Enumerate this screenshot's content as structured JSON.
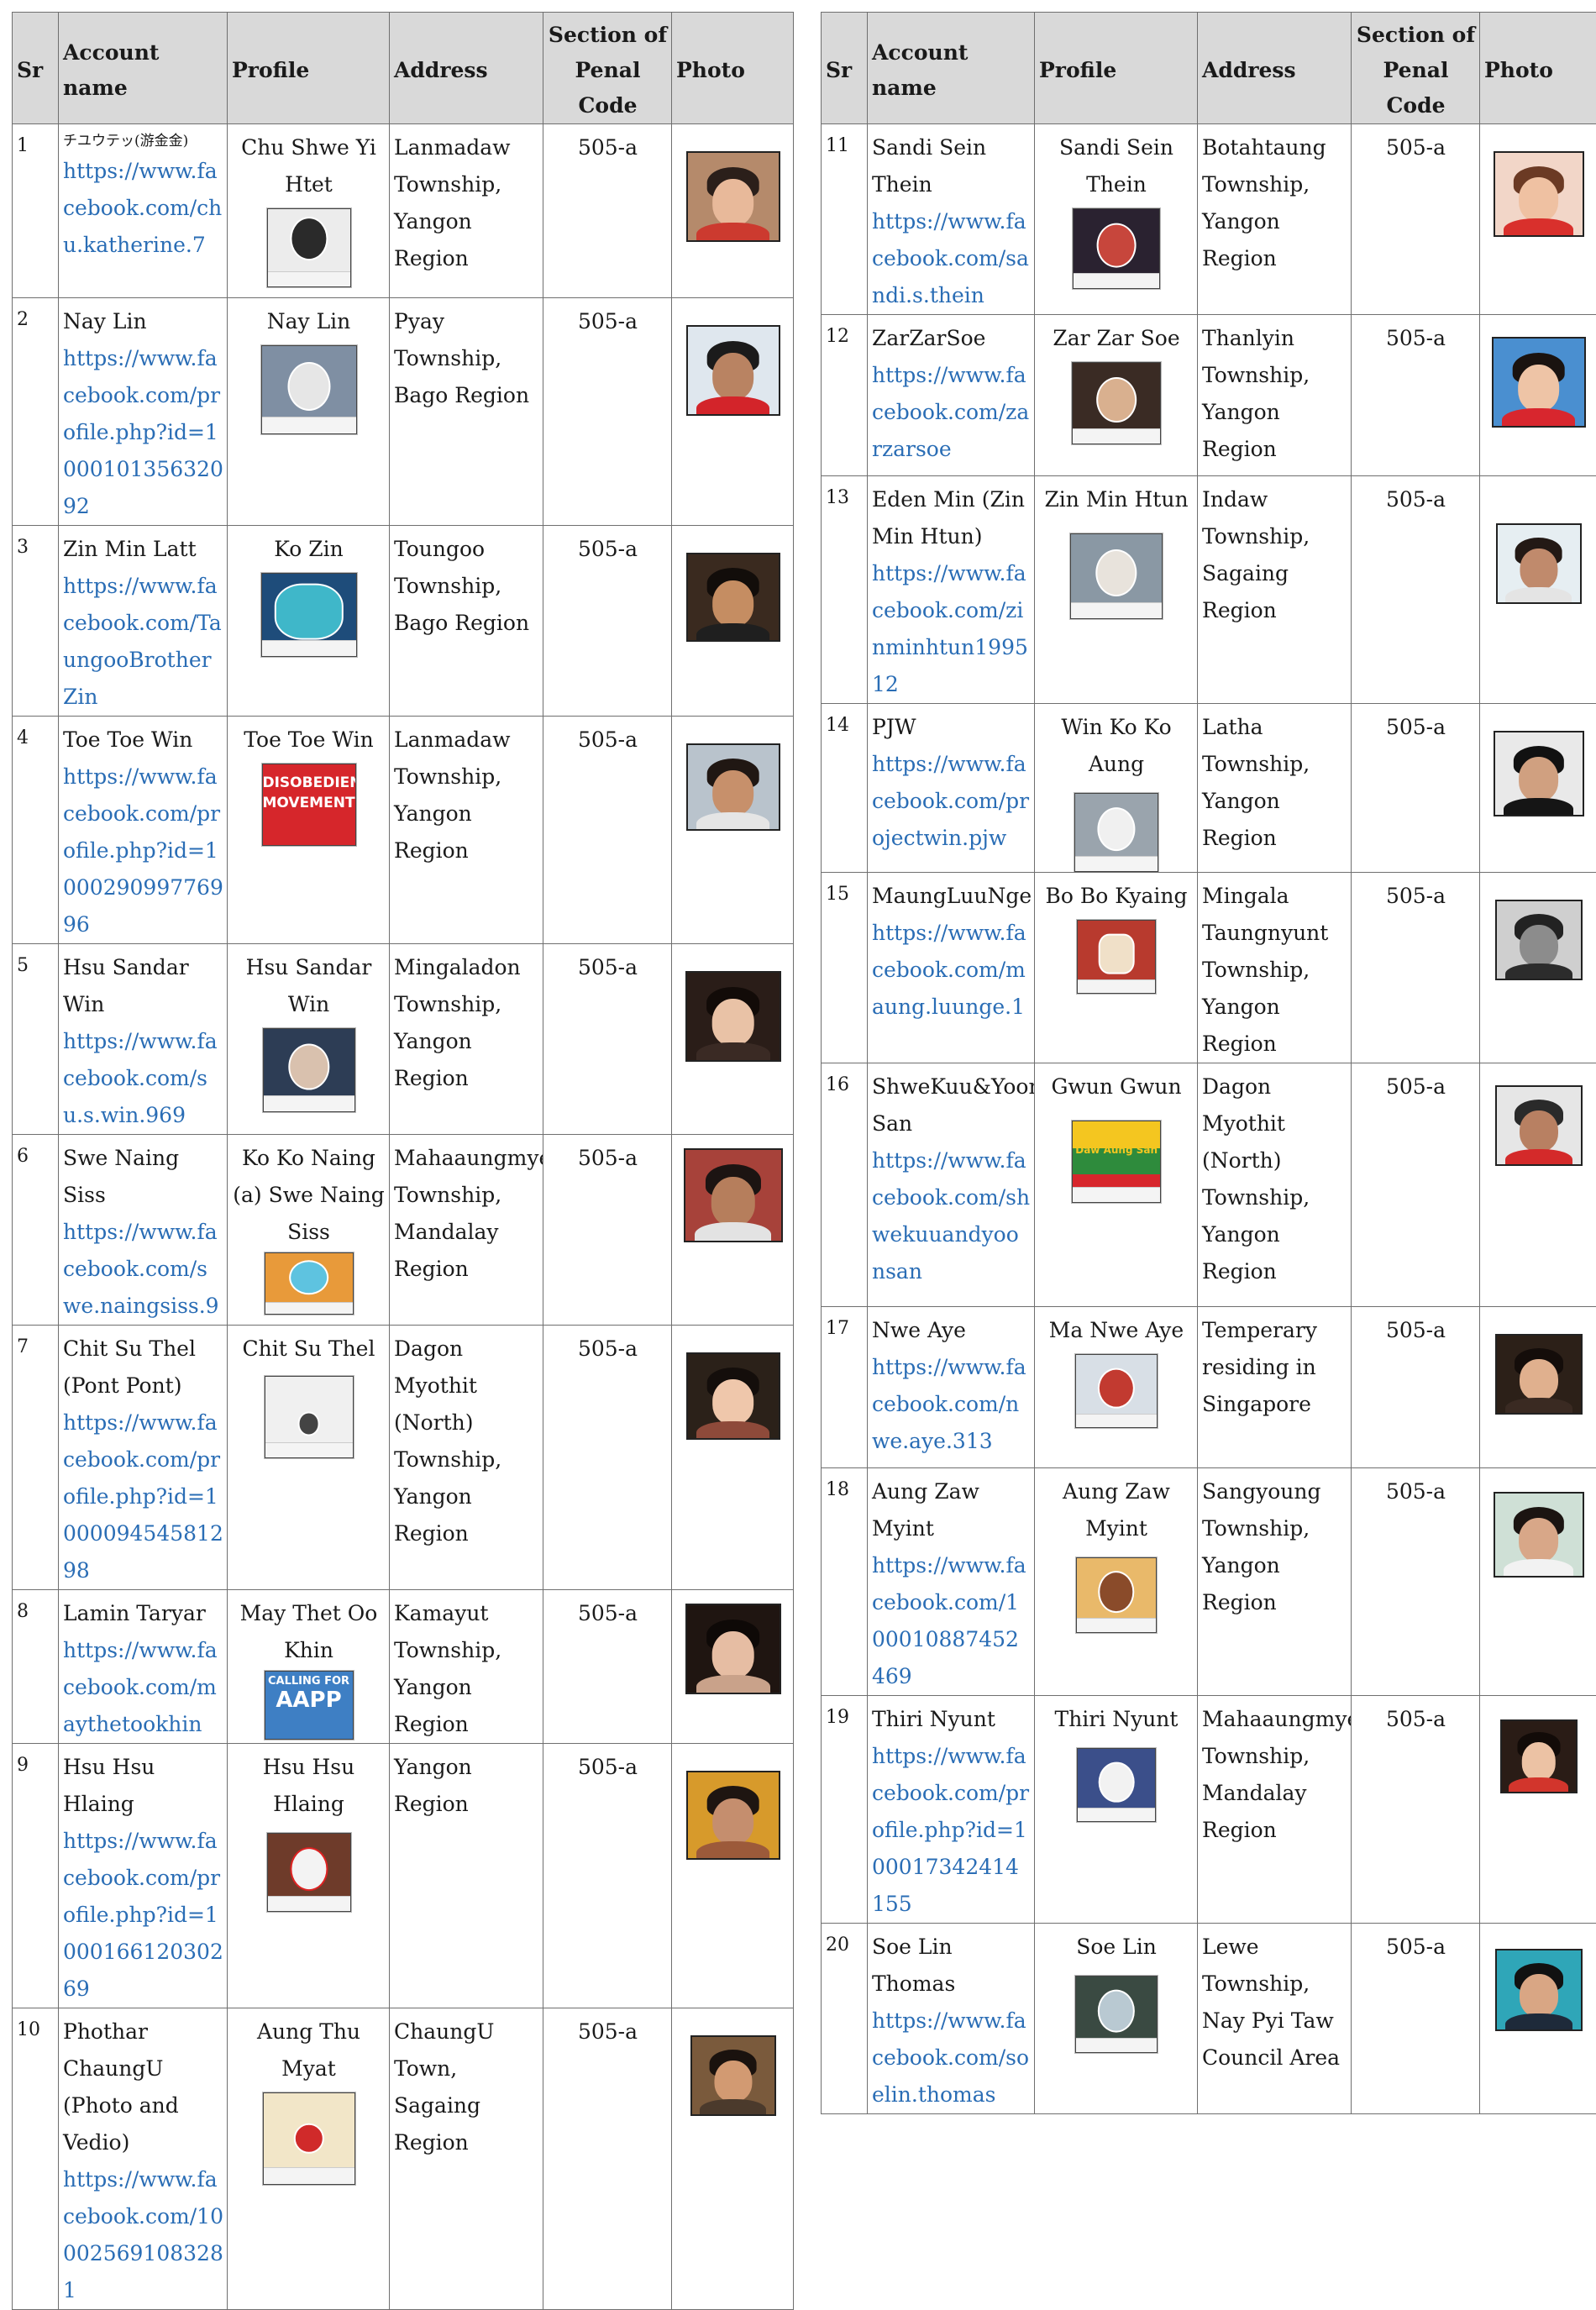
{
  "headers": {
    "sr": "Sr",
    "account_name": "Account name",
    "profile": "Profile",
    "address": "Address",
    "section_line1": "Section of",
    "section_line2": "Penal Code",
    "photo": "Photo"
  },
  "rows": [
    {
      "sr": "1",
      "account_name": "チユウテッ(游金金)",
      "url": "https://www.facebook.com/chu.katherine.7",
      "profile": "Chu Shwe Yi Htet",
      "address": "Lanmadaw Township, Yangon Region",
      "section": "505-a"
    },
    {
      "sr": "2",
      "account_name": "Nay Lin",
      "url": "https://www.facebook.com/profile.php?id=100010135632092",
      "profile": "Nay Lin",
      "address": "Pyay Township, Bago Region",
      "section": "505-a"
    },
    {
      "sr": "3",
      "account_name": "Zin Min Latt",
      "url": "https://www.facebook.com/TaungooBrotherZin",
      "profile": "Ko Zin",
      "address": "Toungoo Township, Bago Region",
      "section": "505-a"
    },
    {
      "sr": "4",
      "account_name": "Toe Toe Win",
      "url": "https://www.facebook.com/profile.php?id=100029099776996",
      "profile": "Toe Toe Win",
      "address": "Lanmadaw Township, Yangon Region",
      "section": "505-a",
      "banner": "DISOBEDIENCE MOVEMENT"
    },
    {
      "sr": "5",
      "account_name": "Hsu Sandar Win",
      "url": "https://www.facebook.com/su.s.win.969",
      "profile": "Hsu Sandar Win",
      "address": "Mingaladon Township, Yangon Region",
      "section": "505-a"
    },
    {
      "sr": "6",
      "account_name": "Swe Naing Siss",
      "url": "https://www.facebook.com/swe.naingsiss.9",
      "profile": "Ko Ko Naing (a) Swe Naing Siss",
      "address": "Mahaaungmye Township, Mandalay Region",
      "section": "505-a"
    },
    {
      "sr": "7",
      "account_name": "Chit Su Thel (Pont Pont)",
      "url": "https://www.facebook.com/profile.php?id=100009454581298",
      "profile": "Chit Su Thel",
      "address": "Dagon Myothit (North) Township, Yangon Region",
      "section": "505-a"
    },
    {
      "sr": "8",
      "account_name": "Lamin Taryar",
      "url": "https://www.facebook.com/maythetookhin",
      "profile": "May Thet Oo Khin",
      "address": "Kamayut Township, Yangon Region",
      "section": "505-a",
      "banner_top": "CALLING FOR",
      "banner_big": "AAPP"
    },
    {
      "sr": "9",
      "account_name": "Hsu Hsu Hlaing",
      "url": "https://www.facebook.com/profile.php?id=100016612030269",
      "profile": "Hsu Hsu Hlaing",
      "address": "Yangon Region",
      "section": "505-a"
    },
    {
      "sr": "10",
      "account_name": "Phothar ChaungU (Photo and Vedio)",
      "url": "https://www.facebook.com/100025691083281",
      "profile": "Aung Thu Myat",
      "address": "ChaungU Town, Sagaing Region",
      "section": "505-a"
    },
    {
      "sr": "11",
      "account_name": "Sandi Sein Thein",
      "url": "https://www.facebook.com/sandi.s.thein",
      "profile": "Sandi Sein Thein",
      "address": "Botahtaung Township, Yangon Region",
      "section": "505-a"
    },
    {
      "sr": "12",
      "account_name": "ZarZarSoe",
      "url": "https://www.facebook.com/zarzarsoe",
      "profile": "Zar Zar Soe",
      "address": "Thanlyin Township, Yangon Region",
      "section": "505-a"
    },
    {
      "sr": "13",
      "account_name": "Eden Min (Zin Min Htun)",
      "url": "https://www.facebook.com/zinminhtun199512",
      "profile": "Zin Min Htun",
      "address": "Indaw Township, Sagaing Region",
      "section": "505-a"
    },
    {
      "sr": "14",
      "account_name": "PJW",
      "url": "https://www.facebook.com/projectwin.pjw",
      "profile": "Win Ko Ko Aung",
      "address": "Latha Township, Yangon Region",
      "section": "505-a"
    },
    {
      "sr": "15",
      "account_name": "MaungLuuNge",
      "url": "https://www.facebook.com/maung.luunge.1",
      "profile": "Bo Bo Kyaing",
      "address": "Mingala Taungnyunt Township, Yangon Region",
      "section": "505-a"
    },
    {
      "sr": "16",
      "account_name": "ShweKuu&Yoon San",
      "url": "https://www.facebook.com/shwekuuandyoonsan",
      "profile": "Gwun Gwun",
      "address": "Dagon Myothit (North) Township, Yangon Region",
      "section": "505-a",
      "banner": "We Stand With Daw Aung San"
    },
    {
      "sr": "17",
      "account_name": "Nwe Aye",
      "url": "https://www.facebook.com/nwe.aye.313",
      "profile": "Ma Nwe Aye",
      "address": "Temperary residing in Singapore",
      "section": "505-a"
    },
    {
      "sr": "18",
      "account_name": "Aung Zaw Myint",
      "url": "https://www.facebook.com/100010887452469",
      "profile": "Aung Zaw Myint",
      "address": "Sangyoung Township, Yangon Region",
      "section": "505-a"
    },
    {
      "sr": "19",
      "account_name": "Thiri Nyunt",
      "url": "https://www.facebook.com/profile.php?id=100017342414155",
      "profile": "Thiri Nyunt",
      "address": "Mahaaungmye Township, Mandalay Region",
      "section": "505-a"
    },
    {
      "sr": "20",
      "account_name": "Soe Lin Thomas",
      "url": "https://www.facebook.com/soelin.thomas",
      "profile": "Soe Lin",
      "address": "Lewe Township, Nay Pyi Taw Council Area",
      "section": "505-a"
    }
  ],
  "colors": {
    "header_bg": "#d9d9d9",
    "link": "#2a6db5",
    "border": "#6f6f6f"
  }
}
